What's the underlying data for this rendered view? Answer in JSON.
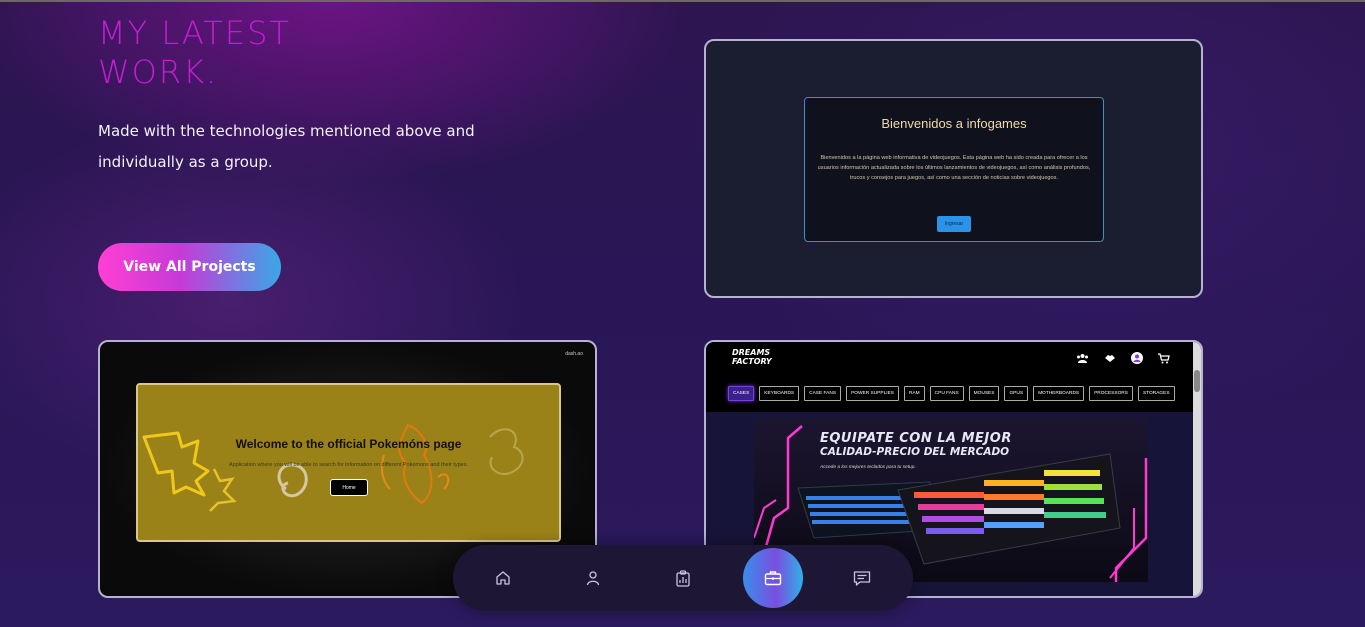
{
  "section": {
    "title_line1": "MY LATEST",
    "title_line2": "WORK.",
    "intro": "Made with the technologies mentioned above and individually as a group.",
    "cta_label": "View All Projects"
  },
  "colors": {
    "title": "#c21ed0",
    "cta_gradient_start": "#ff3fd4",
    "cta_gradient_end": "#3aa7e6",
    "card_border": "#b7b2cf"
  },
  "projects": {
    "infogames": {
      "title": "Bienvenidos a infogames",
      "text": "Bienvenidos a la página web informativa de videojuegos. Esta página web ha sido creada para ofrecer a los usuarios información actualizada sobre los últimos lanzamientos de videojuegos, así como análisis profundos, trucos y consejos para juegos, así como una sección de noticias sobre videojuegos.",
      "button": "Ingresar"
    },
    "pokemon": {
      "brand": "dash.ao",
      "title": "Welcome to the official Pokemóns page",
      "text": "Application where you will be able to search for information on different Pokemons and their types.",
      "button": "Home"
    },
    "dreams": {
      "logo_line1": "DREAMS",
      "logo_line2": "FACTORY",
      "nav": [
        "CASES",
        "KEYBOARDS",
        "CASE FANS",
        "POWER SUPPLIES",
        "RAM",
        "CPU FANS",
        "MOUSES",
        "GPUS",
        "MOTHERBOARDS",
        "PROCESSORS",
        "STORAGES"
      ],
      "hero_line1": "EQUIPATE CON LA MEJOR",
      "hero_line2": "CALIDAD-PRECIO DEL MERCADO",
      "hero_sub": "Accede a los mejores teclados para tu setup."
    }
  },
  "bottom_nav": {
    "items": [
      "home-icon",
      "user-icon",
      "clipboard-chart-icon",
      "briefcase-icon",
      "message-icon"
    ],
    "active": "briefcase-icon"
  }
}
